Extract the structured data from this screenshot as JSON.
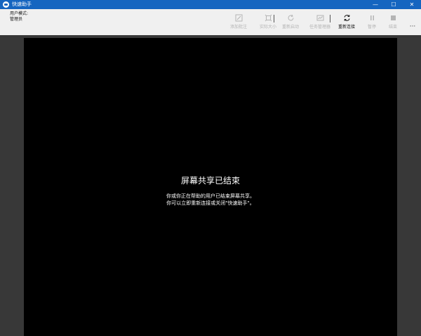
{
  "window": {
    "title": "快速助手",
    "controls": {
      "minimize": "—",
      "maximize": "☐",
      "close": "✕"
    }
  },
  "toolbar": {
    "mode_label": "用户模式:",
    "mode_value": "管理员",
    "buttons": [
      {
        "label": "添加批注",
        "icon": "annotate-icon",
        "enabled": false
      },
      {
        "label": "实际大小",
        "icon": "actual-size-icon",
        "enabled": false
      },
      {
        "label": "重新启动",
        "icon": "restart-icon",
        "enabled": false
      },
      {
        "label": "任务管理器",
        "icon": "task-manager-icon",
        "enabled": false
      },
      {
        "label": "重新连接",
        "icon": "reconnect-icon",
        "enabled": true
      },
      {
        "label": "暂停",
        "icon": "pause-icon",
        "enabled": false
      },
      {
        "label": "结束",
        "icon": "stop-icon",
        "enabled": false
      }
    ],
    "more": "···"
  },
  "remote": {
    "message_title": "屏幕共享已结束",
    "message_line1": "你或你正在帮助的用户已结束屏幕共享。",
    "message_line2": "你可以立即重新连接或关闭\"快速助手\"。"
  },
  "colors": {
    "titlebar": "#1565c0",
    "toolbar": "#f0f0f0",
    "frame": "#383838",
    "screen": "#000000",
    "disabled_text": "#b4b4b4"
  }
}
